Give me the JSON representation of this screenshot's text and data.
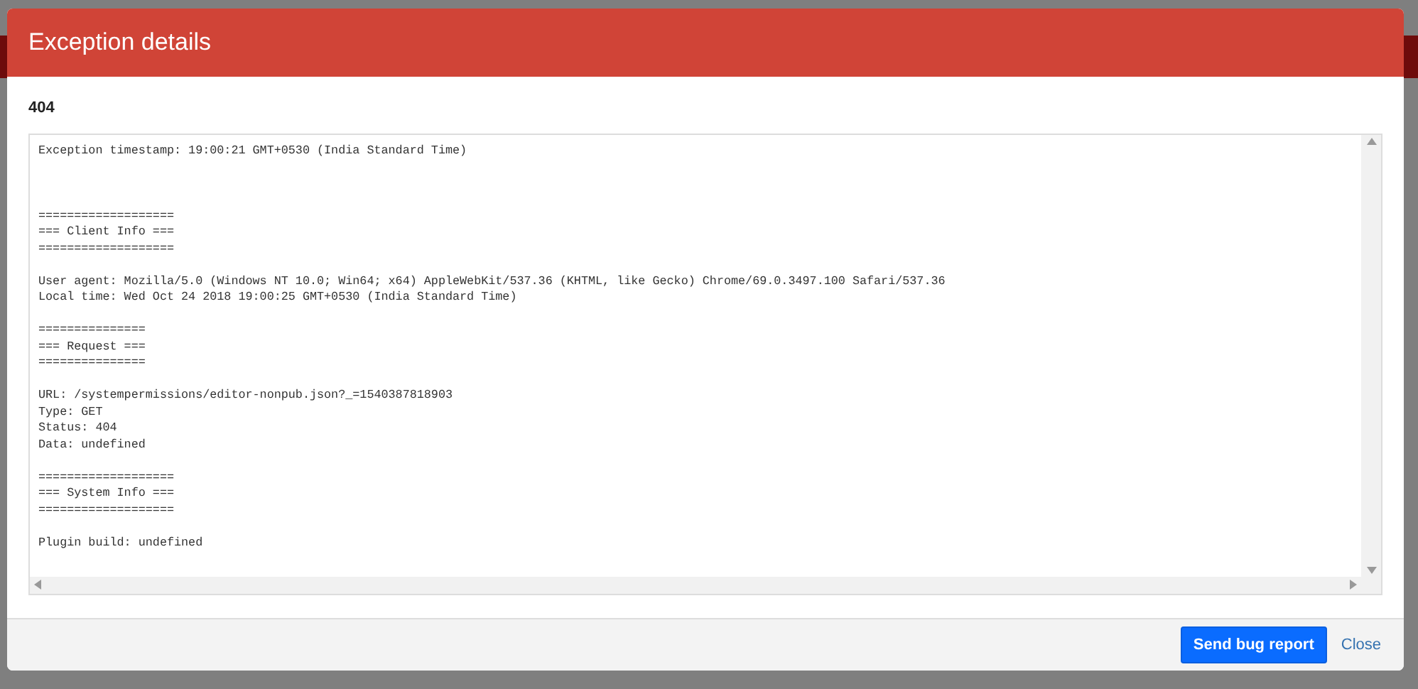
{
  "dialog": {
    "title": "Exception details",
    "heading": "404",
    "log_blocks": [
      [
        "Exception timestamp: 19:00:21 GMT+0530 (India Standard Time)"
      ],
      [
        "===================",
        "=== Client Info ===",
        "==================="
      ],
      [
        "User agent: Mozilla/5.0 (Windows NT 10.0; Win64; x64) AppleWebKit/537.36 (KHTML, like Gecko) Chrome/69.0.3497.100 Safari/537.36",
        "Local time: Wed Oct 24 2018 19:00:25 GMT+0530 (India Standard Time)"
      ],
      [
        "===============",
        "=== Request ===",
        "==============="
      ],
      [
        "URL: /systempermissions/editor-nonpub.json?_=1540387818903",
        "Type: GET",
        "Status: 404",
        "Data: undefined"
      ],
      [
        "===================",
        "=== System Info ===",
        "==================="
      ],
      [
        "Plugin build: undefined"
      ]
    ],
    "buttons": [
      {
        "label": "Send bug report",
        "kind": "primary"
      },
      {
        "label": "Close",
        "kind": "link"
      }
    ]
  }
}
